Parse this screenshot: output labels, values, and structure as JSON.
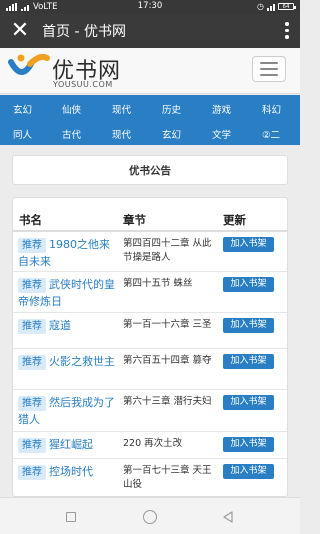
{
  "status": {
    "carrier": "VoLTE",
    "time": "17:30",
    "battery": "64"
  },
  "appbar": {
    "title": "首页 - 优书网"
  },
  "site": {
    "brand": "优书网",
    "domain": "YOUSUU.COM"
  },
  "categories": {
    "row1": [
      "玄幻",
      "仙侠",
      "现代",
      "历史",
      "游戏",
      "科幻"
    ],
    "row2": [
      "同人",
      "古代",
      "现代",
      "玄幻",
      "文学",
      "②二"
    ]
  },
  "notice": "优书公告",
  "table": {
    "headers": [
      "书名",
      "章节",
      "更新"
    ],
    "tag_label": "推荐",
    "add_label": "加入书架",
    "rows": [
      {
        "title": "1980之他来自未来",
        "chapter": "第四百四十二章 从此节操是路人"
      },
      {
        "title": "武侠时代的皇帝修炼日",
        "chapter": "第四十五节 蛛丝"
      },
      {
        "title": "寇道",
        "chapter": "第一百一十六章 三圣"
      },
      {
        "title": "火影之救世主",
        "chapter": "第六百五十四章 篡夺"
      },
      {
        "title": "然后我成为了猎人",
        "chapter": "第六十三章 潜行夫妇"
      },
      {
        "title": "猩红崛起",
        "chapter": "220 再次土改"
      },
      {
        "title": "控场时代",
        "chapter": "第一百七十三章 天王山役"
      }
    ]
  },
  "colors": {
    "accent": "#2a7fc4",
    "appbar": "#3a3a3a",
    "statusbar": "#383838"
  }
}
